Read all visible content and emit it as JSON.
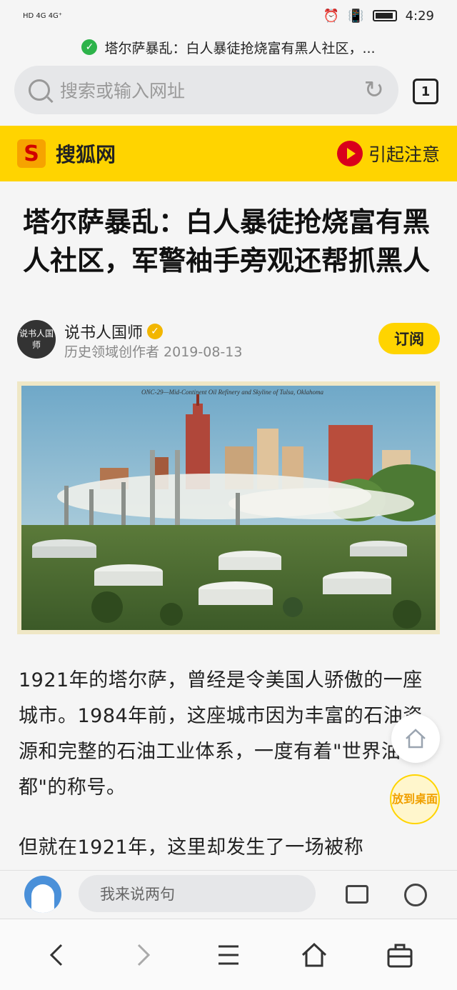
{
  "status_bar": {
    "network": "HD 4G 4G⁺",
    "time": "4:29"
  },
  "page_hint": {
    "text": "塔尔萨暴乱：白人暴徒抢烧富有黑人社区，..."
  },
  "address_bar": {
    "placeholder": "搜索或输入网址",
    "tab_count": "1"
  },
  "site_header": {
    "logo_letter": "S",
    "site_name": "搜狐网",
    "attention_label": "引起注意"
  },
  "article": {
    "title": "塔尔萨暴乱：白人暴徒抢烧富有黑人社区，军警袖手旁观还帮抓黑人",
    "author": {
      "avatar_text": "说书人国师",
      "name": "说书人国师",
      "meta": "历史领域创作者  2019-08-13"
    },
    "subscribe_label": "订阅",
    "image_caption": "ONC-29—Mid-Continent Oil Refinery and Skyline of Tulsa, Oklahoma",
    "paragraphs": [
      "1921年的塔尔萨，曾经是令美国人骄傲的一座城市。1984年前，这座城市因为丰富的石油资源和完整的石油工业体系，一度有着\"世界油都\"的称号。",
      "但就在1921年，这里却发生了一场被称"
    ]
  },
  "floating": {
    "desktop_label": "放到桌面"
  },
  "comment_bar": {
    "placeholder": "我来说两句"
  },
  "colors": {
    "brand_yellow": "#ffd400",
    "accent_red": "#d9001b"
  }
}
